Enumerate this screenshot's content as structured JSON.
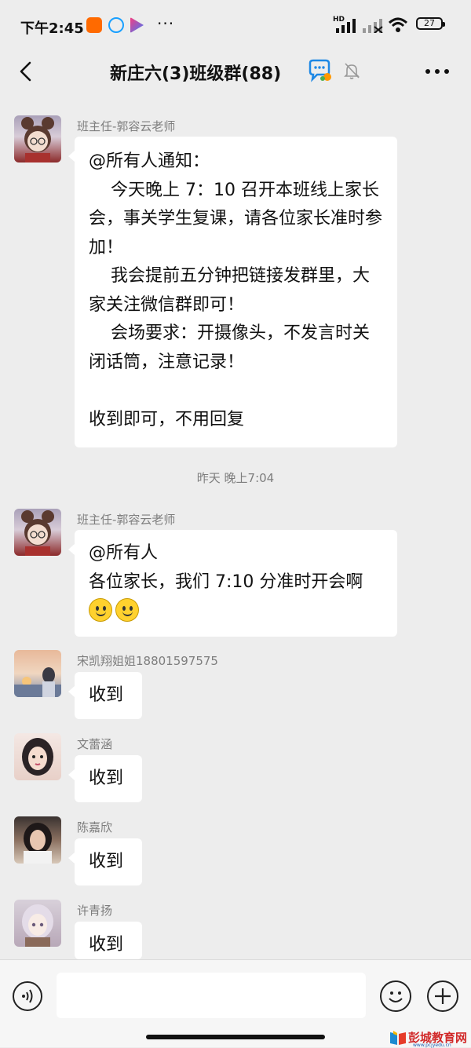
{
  "status_bar": {
    "time": "下午2:45",
    "dots": "···",
    "hd": "HD",
    "battery": "27"
  },
  "header": {
    "title": "新庄六(3)班级群(88)"
  },
  "messages": [
    {
      "sender": "班主任-郭容云老师",
      "text": "@所有人通知：\n    今天晚上 7：10 召开本班线上家长会，事关学生复课，请各位家长准时参加！\n    我会提前五分钟把链接发群里，大家关注微信群即可！\n    会场要求：开摄像头，不发言时关闭话筒，注意记录！\n\n收到即可，不用回复"
    },
    {
      "sender": "班主任-郭容云老师",
      "text": "@所有人\n各位家长，我们 7:10 分准时开会啊"
    },
    {
      "sender": "宋凯翔姐姐18801597575",
      "text": "收到"
    },
    {
      "sender": "文蕾涵",
      "text": "收到"
    },
    {
      "sender": "陈嘉欣",
      "text": "收到"
    },
    {
      "sender": "许青扬",
      "text": "收到"
    }
  ],
  "timestamp": "昨天 晚上7:04",
  "watermark": {
    "name": "彭城教育网",
    "url": "www.pcjyedu.cn"
  },
  "colors": {
    "background": "#ededed",
    "bubble": "#ffffff",
    "sender_gray": "#7d7d7d",
    "bottom_bar": "#f6f6f6"
  }
}
